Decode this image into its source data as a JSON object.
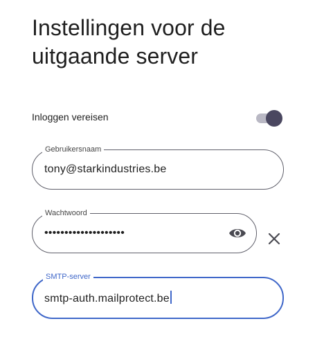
{
  "page": {
    "title_line1": "Instellingen voor de",
    "title_line2": "uitgaande server"
  },
  "require_login": {
    "label": "Inloggen vereisen",
    "enabled": true
  },
  "username": {
    "label": "Gebruikersnaam",
    "value": "tony@starkindustries.be"
  },
  "password": {
    "label": "Wachtwoord",
    "masked_value": "••••••••••••••••••••",
    "visibility_icon": "eye-icon",
    "clear_icon": "close-icon"
  },
  "smtp": {
    "label": "SMTP-server",
    "value": "smtp-auth.mailprotect.be",
    "focused": true
  },
  "colors": {
    "accent": "#3f67c9",
    "toggle_thumb": "#4a4760",
    "toggle_track": "#b9b8c4",
    "outline": "#5f5f6a"
  }
}
